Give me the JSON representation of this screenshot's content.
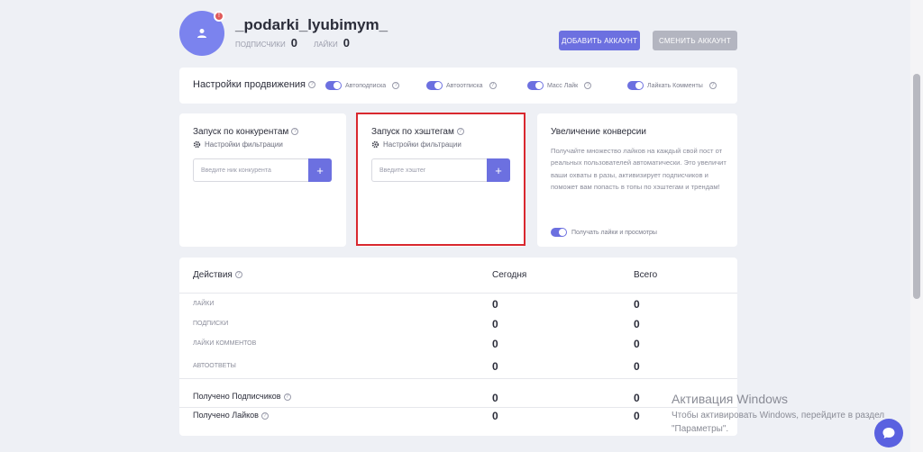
{
  "profile": {
    "username": "_podarki_lyubimym_",
    "notif_count": "!",
    "followers_label": "подписчики",
    "followers_value": "0",
    "likes_label": "лайки",
    "likes_value": "0",
    "add_account_label": "ДОБАВИТЬ АККАУНТ",
    "switch_account_label": "СМЕНИТЬ АККАУНТ"
  },
  "promotion": {
    "title": "Настройки продвижения",
    "toggles": [
      {
        "label": "Автоподписка",
        "on": true
      },
      {
        "label": "Автоотписка",
        "on": true
      },
      {
        "label": "Масс Лайк",
        "on": true
      },
      {
        "label": "Лайкать Комменты",
        "on": true
      }
    ]
  },
  "competitors": {
    "title": "Запуск по конкурентам",
    "filter_label": "Настройки фильтрации",
    "input_placeholder": "Введите ник конкурента",
    "add_symbol": "+"
  },
  "hashtags": {
    "title": "Запуск по хэштегам",
    "filter_label": "Настройки фильтрации",
    "input_placeholder": "Введите хэштег",
    "add_symbol": "+"
  },
  "conversion": {
    "title": "Увеличение конверсии",
    "text": "Получайте множество лайков на каждый свой пост от реальных пользователей автоматически. Это увеличит ваши охваты в разы, активизирует подписчиков и поможет вам попасть в топы по хэштегам и трендам!",
    "toggle_label": "Получать лайки и просмотры",
    "toggle_on": true
  },
  "actions": {
    "title": "Действия",
    "col_today": "Сегодня",
    "col_total": "Всего",
    "rows": [
      {
        "label": "ЛАЙКИ",
        "today": "0",
        "total": "0"
      },
      {
        "label": "ПОДПИСКИ",
        "today": "0",
        "total": "0"
      },
      {
        "label": "ЛАЙКИ КОММЕНТОВ",
        "today": "0",
        "total": "0"
      },
      {
        "label": "АВТООТВЕТЫ",
        "today": "0",
        "total": "0"
      }
    ],
    "received": [
      {
        "label": "Получено Подписчиков",
        "today": "0",
        "total": "0"
      },
      {
        "label": "Получено Лайков",
        "today": "0",
        "total": "0"
      }
    ]
  },
  "watermark": {
    "title": "Активация Windows",
    "text": "Чтобы активировать Windows, перейдите в раздел \"Параметры\"."
  },
  "colors": {
    "accent": "#6c70e0",
    "highlight_border": "#d9282f",
    "background": "#eef0f5"
  },
  "info_symbol": "?",
  "icons": [
    "user-icon",
    "gear-icon",
    "info-icon",
    "chat-icon",
    "plus-icon"
  ]
}
